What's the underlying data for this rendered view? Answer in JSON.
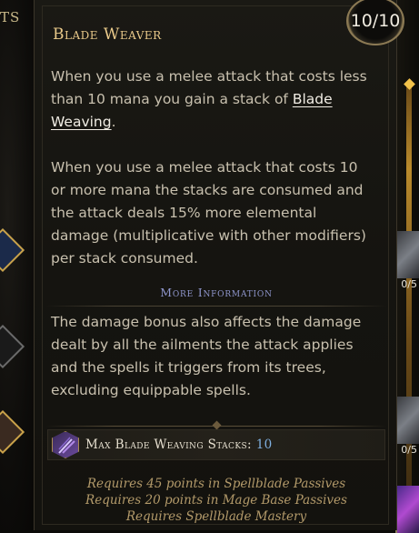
{
  "background": {
    "left_label": "TS",
    "right_counts": [
      "0/5",
      "0/5"
    ]
  },
  "tooltip": {
    "title": "Blade Weaver",
    "points_badge": "10/10",
    "paragraph1_text": "When you use a melee attack that costs less than 10 mana you gain a stack of ",
    "paragraph1_link": "Blade Weaving",
    "paragraph1_end": ".",
    "paragraph2": "When you use a melee attack that costs 10 or more mana the stacks are consumed and the attack deals 15% more elemental damage (multiplicative with other modifiers) per stack consumed.",
    "more_info_label": "More Information",
    "paragraph3": "The damage bonus also affects the damage dealt by all the ailments the attack applies and the spells it triggers from its trees, excluding equippable spells.",
    "stat": {
      "icon": "blade-weaving-icon",
      "label": "Max Blade Weaving Stacks: ",
      "value": "10"
    },
    "requirements": [
      "Requires 45 points in Spellblade Passives",
      "Requires 20 points in Mage Base Passives",
      "Requires Spellblade Mastery"
    ]
  },
  "colors": {
    "title": "#e9c98a",
    "body_text": "#c8c0ae",
    "more_info": "#8f96cc",
    "stat_value": "#7fb0e0",
    "requirement": "#b39a6a"
  }
}
